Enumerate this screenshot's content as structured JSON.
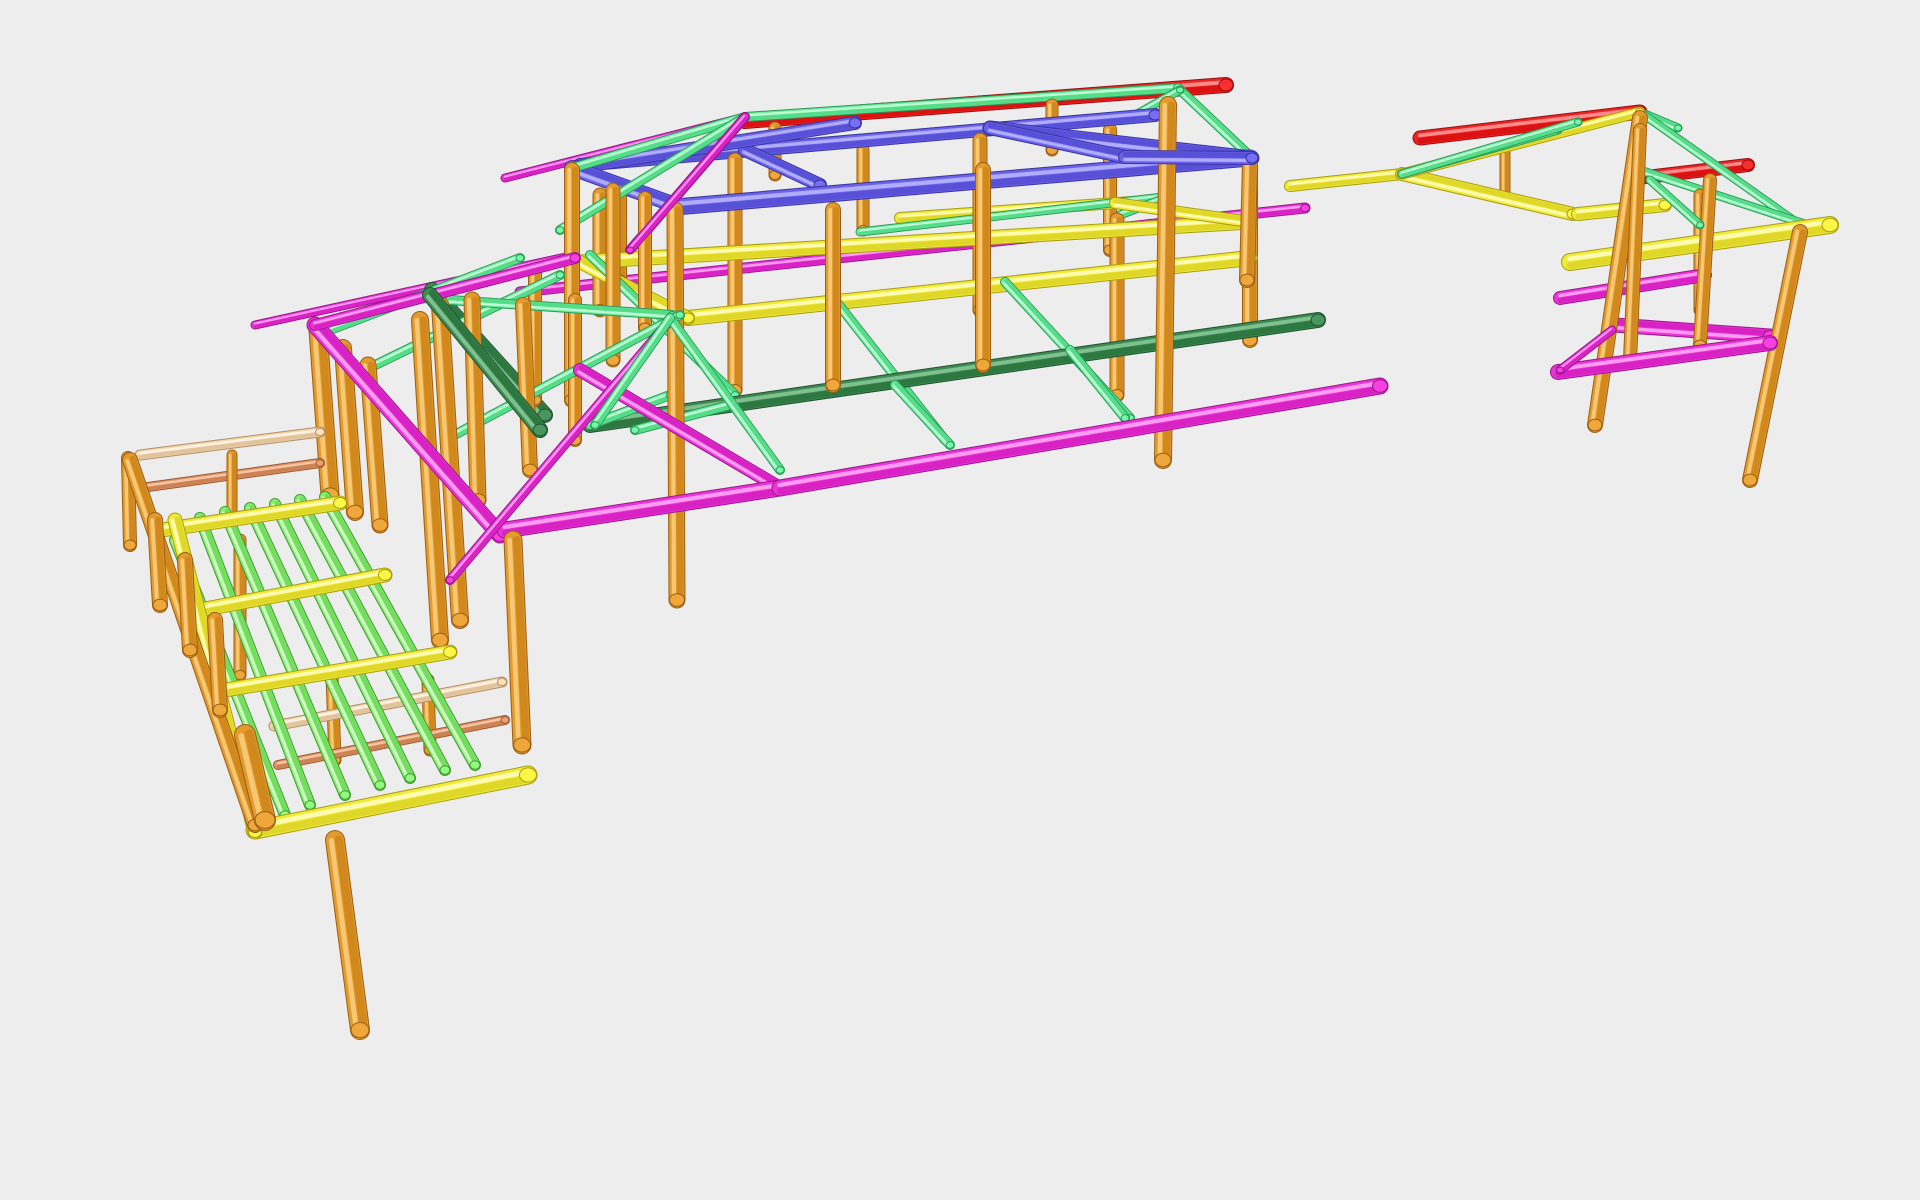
{
  "scene": {
    "background": "#ededed",
    "member_types": [
      {
        "id": "post",
        "icon": "timber-post-icon",
        "color": "#e39a2e",
        "edge": "#9a5f12",
        "highlight": "#f7c874"
      },
      {
        "id": "ridge",
        "icon": "ridge-beam-icon",
        "color": "#ee2424",
        "edge": "#9c1010",
        "highlight": "#ff8a8a"
      },
      {
        "id": "purlin",
        "icon": "purlin-icon",
        "color": "#6a63ea",
        "edge": "#3a34a0",
        "highlight": "#b0acff"
      },
      {
        "id": "rafter",
        "icon": "rafter-icon",
        "color": "#ea34d6",
        "edge": "#9c168e",
        "highlight": "#ff9cf2"
      },
      {
        "id": "brace",
        "icon": "brace-icon",
        "color": "#66ee9a",
        "edge": "#2e9a5a",
        "highlight": "#c4ffd8"
      },
      {
        "id": "beam",
        "icon": "floor-beam-icon",
        "color": "#f2ea3a",
        "edge": "#a89e10",
        "highlight": "#fffbb0"
      },
      {
        "id": "tie",
        "icon": "tie-beam-icon",
        "color": "#3e8a52",
        "edge": "#1f5230",
        "highlight": "#7fc090"
      },
      {
        "id": "rail",
        "icon": "handrail-icon",
        "color": "#f3d5ae",
        "edge": "#b39066",
        "highlight": "#fff3e3"
      },
      {
        "id": "rail2",
        "icon": "handrail-lower-icon",
        "color": "#df9466",
        "edge": "#9e5a32",
        "highlight": "#f7c6a6"
      },
      {
        "id": "joist",
        "icon": "joist-icon",
        "color": "#86ee70",
        "edge": "#3f9a2e",
        "highlight": "#d2ffc6"
      }
    ]
  }
}
